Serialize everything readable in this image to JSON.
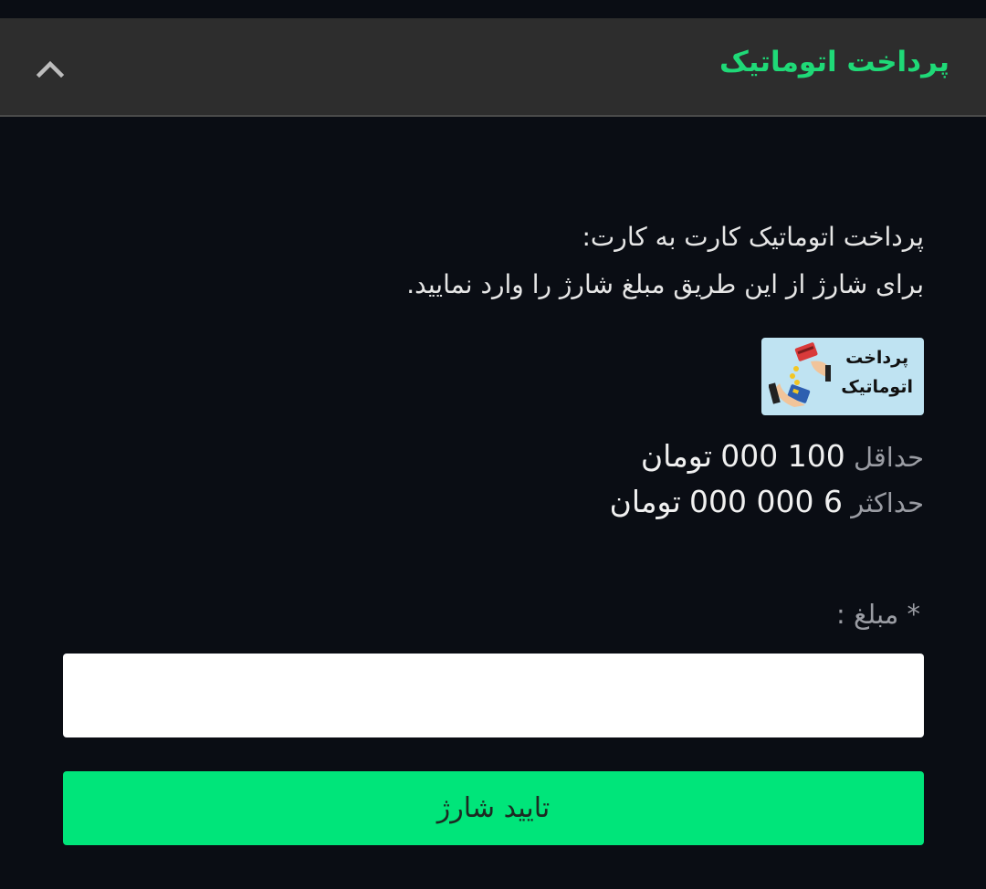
{
  "header": {
    "title": "پرداخت اتوماتیک",
    "collapse_icon": "chevron-up-icon"
  },
  "description": {
    "line1": "پرداخت اتوماتیک کارت به کارت:",
    "line2": "برای شارژ از این طریق مبلغ شارژ را وارد نمایید."
  },
  "logo": {
    "line1": "پرداخت",
    "line2": "اتوماتیک"
  },
  "limits": {
    "min_label": "حداقل",
    "min_value": "100 000",
    "min_unit": "تومان",
    "max_label": "حداکثر",
    "max_value": "6 000 000",
    "max_unit": "تومان"
  },
  "amount": {
    "label": "* مبلغ :",
    "value": "",
    "placeholder": ""
  },
  "submit": {
    "label": "تایید شارژ"
  },
  "colors": {
    "accent": "#1fd977",
    "button": "#00e57a",
    "background": "#0a0d14",
    "header_bg": "#2d2d2d"
  }
}
